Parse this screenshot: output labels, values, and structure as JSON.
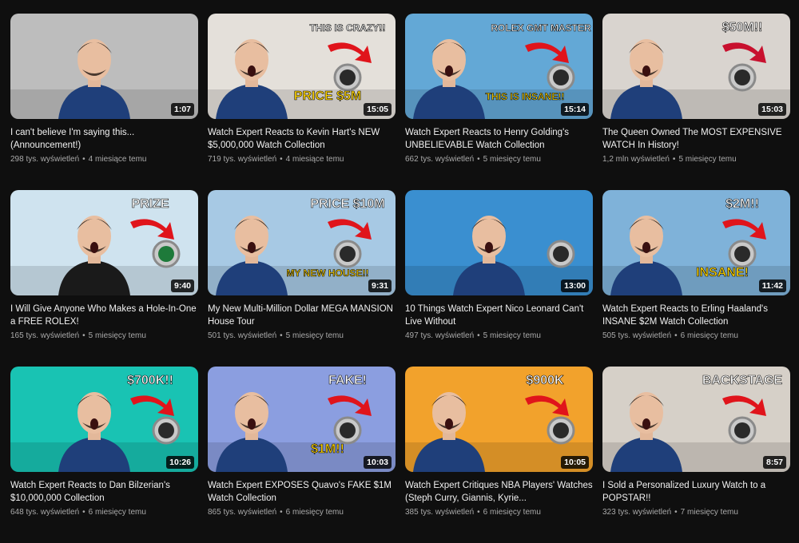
{
  "videos": [
    {
      "title": "I can't believe I'm saying this... (Announcement!)",
      "views": "298 tys. wyświetleń",
      "age": "4 miesiące temu",
      "duration": "1:07",
      "bg": "#bdbdbd",
      "accent": "#8a8a8a",
      "captions": []
    },
    {
      "title": "Watch Expert Reacts to Kevin Hart's NEW $5,000,000 Watch Collection",
      "views": "719 tys. wyświetleń",
      "age": "4 miesiące temu",
      "duration": "15:05",
      "bg": "#e4e0da",
      "accent": "#e0141b",
      "captions": [
        "THIS IS CRAZY!!",
        "PRICE $5M"
      ]
    },
    {
      "title": "Watch Expert Reacts to Henry Golding's UNBELIEVABLE Watch Collection",
      "views": "662 tys. wyświetleń",
      "age": "5 miesięcy temu",
      "duration": "15:14",
      "bg": "#63a8d6",
      "accent": "#e0141b",
      "captions": [
        "ROLEX GMT MASTER II",
        "THIS IS INSANE!!"
      ]
    },
    {
      "title": "The Queen Owned The MOST EXPENSIVE WATCH In History!",
      "views": "1,2 mln wyświetleń",
      "age": "5 miesięcy temu",
      "duration": "15:03",
      "bg": "#d9d4cf",
      "accent": "#c8102e",
      "captions": [
        "$50M!!"
      ]
    },
    {
      "title": "I Will Give Anyone Who Makes a Hole-In-One a FREE ROLEX!",
      "views": "165 tys. wyświetleń",
      "age": "5 miesięcy temu",
      "duration": "9:40",
      "bg": "#cfe3ef",
      "accent": "#e0141b",
      "captions": [
        "PRIZE"
      ]
    },
    {
      "title": "My New Multi-Million Dollar MEGA MANSION House Tour",
      "views": "501 tys. wyświetleń",
      "age": "5 miesięcy temu",
      "duration": "9:31",
      "bg": "#a7c9e4",
      "accent": "#e0141b",
      "captions": [
        "PRICE $10M",
        "MY NEW HOUSE!!"
      ]
    },
    {
      "title": "10 Things Watch Expert Nico Leonard Can't Live Without",
      "views": "497 tys. wyświetleń",
      "age": "5 miesięcy temu",
      "duration": "13:00",
      "bg": "#3a8fd0",
      "accent": "#ffffff",
      "captions": []
    },
    {
      "title": "Watch Expert Reacts to Erling Haaland's INSANE $2M Watch Collection",
      "views": "505 tys. wyświetleń",
      "age": "6 miesięcy temu",
      "duration": "11:42",
      "bg": "#7fb2d9",
      "accent": "#e0141b",
      "captions": [
        "$2M!!",
        "INSANE!"
      ]
    },
    {
      "title": "Watch Expert Reacts to Dan Bilzerian's $10,000,000 Collection",
      "views": "648 tys. wyświetleń",
      "age": "6 miesięcy temu",
      "duration": "10:26",
      "bg": "#19c3b3",
      "accent": "#e0141b",
      "captions": [
        "$700K!!"
      ]
    },
    {
      "title": "Watch Expert EXPOSES Quavo's FAKE $1M Watch Collection",
      "views": "865 tys. wyświetleń",
      "age": "6 miesięcy temu",
      "duration": "10:03",
      "bg": "#8b9ee0",
      "accent": "#e0141b",
      "captions": [
        "FAKE!",
        "$1M!!"
      ]
    },
    {
      "title": "Watch Expert Critiques NBA Players' Watches (Steph Curry, Giannis, Kyrie...",
      "views": "385 tys. wyświetleń",
      "age": "6 miesięcy temu",
      "duration": "10:05",
      "bg": "#f2a22c",
      "accent": "#e0141b",
      "captions": [
        "$900K"
      ]
    },
    {
      "title": "I Sold a Personalized Luxury Watch to a POPSTAR!!",
      "views": "323 tys. wyświetleń",
      "age": "7 miesięcy temu",
      "duration": "8:57",
      "bg": "#d6d0c8",
      "accent": "#e0141b",
      "captions": [
        "BACKSTAGE"
      ]
    }
  ]
}
